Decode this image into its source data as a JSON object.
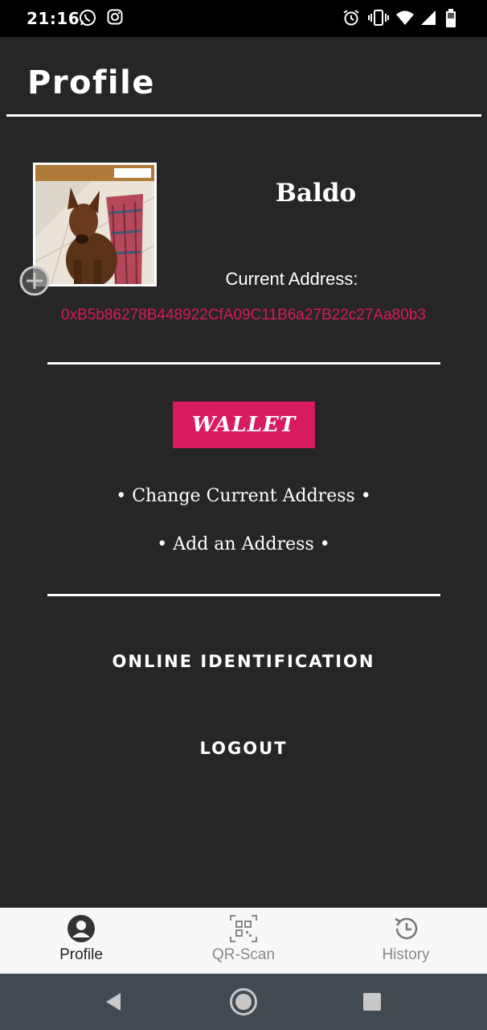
{
  "status_bar": {
    "time": "21:16",
    "icons": [
      "whatsapp-icon",
      "instagram-icon",
      "alarm-icon",
      "vibrate-icon",
      "wifi-icon",
      "signal-icon",
      "battery-icon"
    ]
  },
  "header": {
    "title": "Profile"
  },
  "profile": {
    "name": "Baldo",
    "address_label": "Current Address:",
    "address": "0xB5b86278B448922CfA09C11B6a27B22c27Aa80b3"
  },
  "actions": {
    "wallet": "WALLET",
    "change_address": "• Change Current Address •",
    "add_address": "• Add an Address •"
  },
  "menu": {
    "online_identification": "ONLINE IDENTIFICATION",
    "logout": "LOGOUT"
  },
  "bottom_nav": [
    {
      "label": "Profile",
      "icon": "person-icon",
      "active": true
    },
    {
      "label": "QR-Scan",
      "icon": "qr-code-icon",
      "active": false
    },
    {
      "label": "History",
      "icon": "history-icon",
      "active": false
    }
  ],
  "colors": {
    "background": "#262626",
    "accent": "#d81b60",
    "nav_bg": "#f8f8f8",
    "system_nav_bg": "#424a51"
  }
}
